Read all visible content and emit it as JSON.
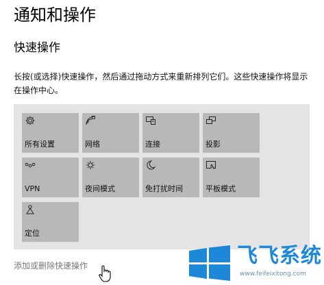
{
  "page": {
    "title": "通知和操作",
    "section_title": "快速操作",
    "description": "长按(或选择)快速操作，然后通过拖动方式来重新排列它们。这些快速操作将显示在操作中心。",
    "add_remove_link": "添加或删除快速操作"
  },
  "quick_actions": [
    {
      "label": "所有设置",
      "icon": "gear-icon"
    },
    {
      "label": "网络",
      "icon": "network-icon"
    },
    {
      "label": "连接",
      "icon": "connect-icon"
    },
    {
      "label": "投影",
      "icon": "project-icon"
    },
    {
      "label": "VPN",
      "icon": "vpn-icon"
    },
    {
      "label": "夜间模式",
      "icon": "night-light-icon"
    },
    {
      "label": "免打扰时间",
      "icon": "moon-icon"
    },
    {
      "label": "平板模式",
      "icon": "tablet-mode-icon"
    },
    {
      "label": "定位",
      "icon": "location-icon"
    }
  ],
  "watermark": {
    "brand": "飞飞系统",
    "domain": "www.feifeixitong.com"
  },
  "colors": {
    "tile": "#b8b8b8",
    "panel": "#e4e4e4",
    "brand": "#1e88d8"
  }
}
